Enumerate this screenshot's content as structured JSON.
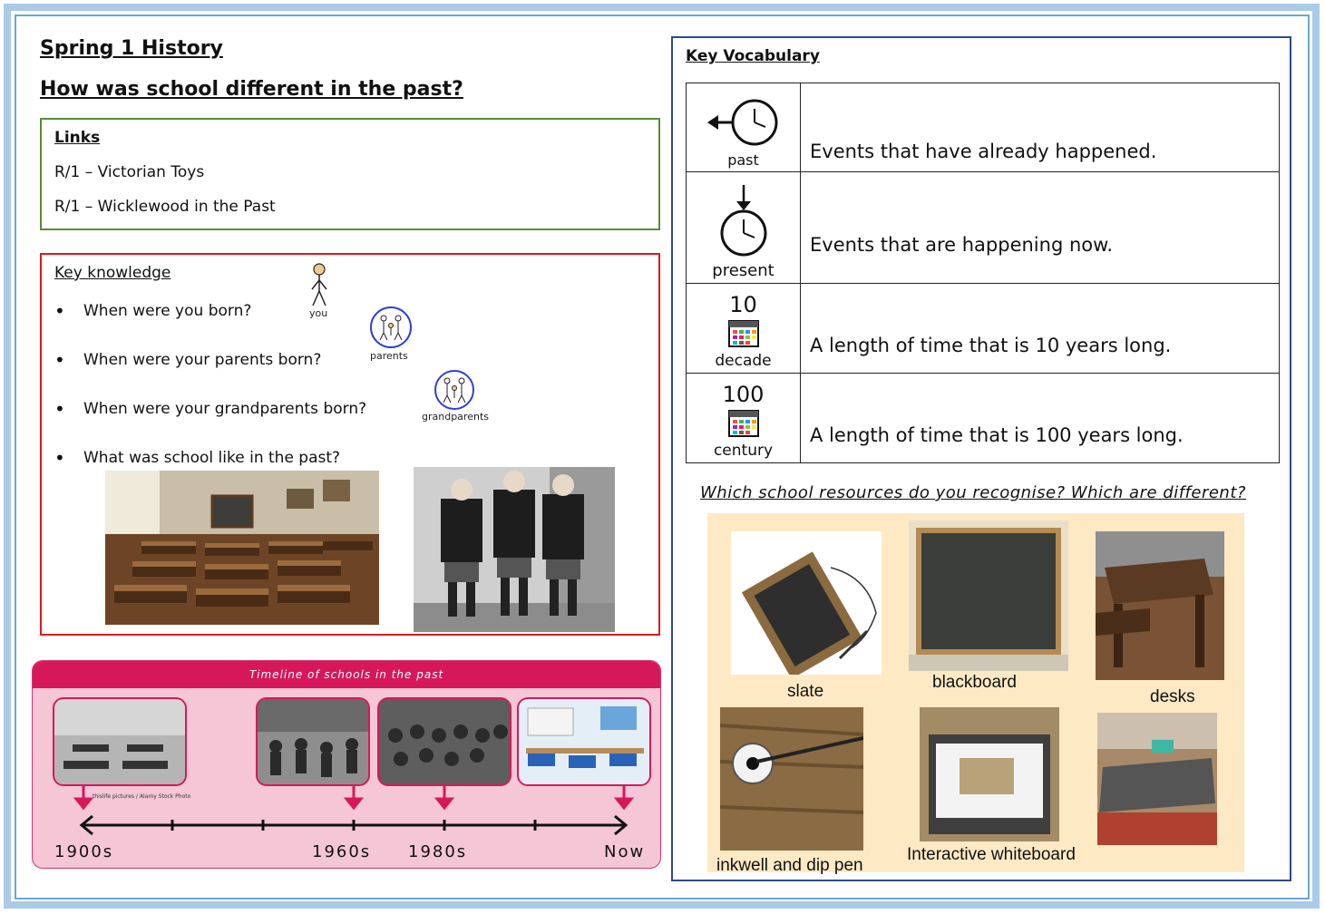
{
  "header": {
    "title": "Spring 1 History",
    "question": "How was school different in the past?"
  },
  "links": {
    "heading": "Links",
    "items": [
      "R/1 – Victorian Toys",
      "R/1 – Wicklewood in the Past"
    ]
  },
  "key_knowledge": {
    "heading": "Key knowledge",
    "questions": [
      "When were you born?",
      "When were your parents born?",
      "When were your grandparents born?",
      "What was school like in the past?"
    ],
    "symbols": {
      "you": "you",
      "parents": "parents",
      "grandparents": "grandparents"
    }
  },
  "timeline": {
    "title": "Timeline of schools in the past",
    "labels": [
      "1900s",
      "1960s",
      "1980s",
      "Now"
    ],
    "credit": "thislife pictures / Alamy Stock Photo"
  },
  "vocabulary": {
    "heading": "Key Vocabulary",
    "rows": [
      {
        "symbol_label": "past",
        "number": "",
        "definition": "Events that have already happened."
      },
      {
        "symbol_label": "present",
        "number": "",
        "definition": "Events that are happening now."
      },
      {
        "symbol_label": "decade",
        "number": "10",
        "definition": "A length of time that is 10 years long."
      },
      {
        "symbol_label": "century",
        "number": "100",
        "definition": "A length of time that is 100 years long."
      }
    ]
  },
  "resources": {
    "question": "Which school resources do you recognise? Which are different?",
    "items": [
      "slate",
      "blackboard",
      "desks",
      "inkwell and dip pen",
      "Interactive whiteboard"
    ]
  },
  "colors": {
    "links_border": "#5b8a3a",
    "knowledge_border": "#e0191e",
    "vocab_border": "#2e4b87",
    "timeline_accent": "#d6185b",
    "timeline_bg": "#f5c6d6",
    "frame": "#a9cbe9"
  }
}
